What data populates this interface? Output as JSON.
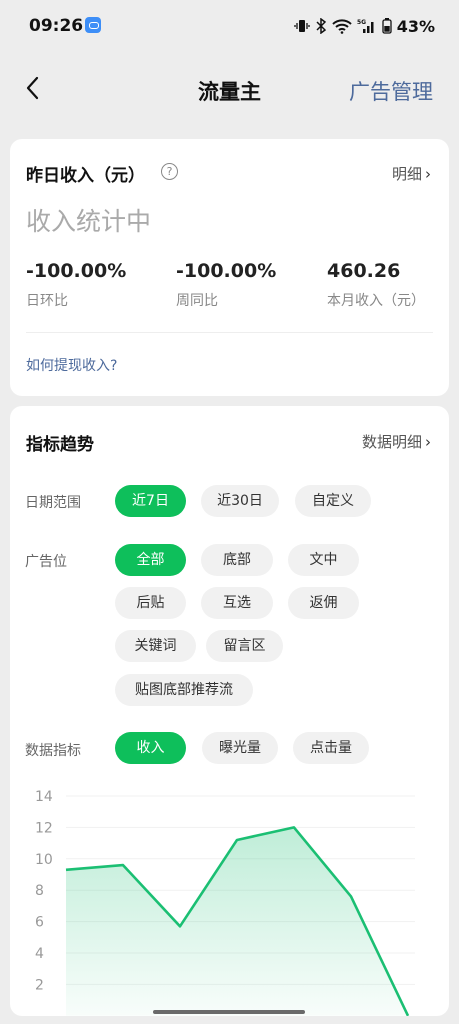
{
  "status_bar": {
    "time": "09:26",
    "battery_pct": "43%",
    "icons": [
      "vibrate-icon",
      "bluetooth-icon",
      "wifi-icon",
      "5g-signal-icon",
      "battery-icon"
    ]
  },
  "nav": {
    "title": "流量主",
    "right_label": "广告管理"
  },
  "income_card": {
    "title": "昨日收入（元）",
    "detail_link": "明细",
    "status_text": "收入统计中",
    "stats": [
      {
        "value": "-100.00%",
        "label": "日环比"
      },
      {
        "value": "-100.00%",
        "label": "周同比"
      },
      {
        "value": "460.26",
        "label": "本月收入（元）"
      }
    ],
    "help_link": "如何提现收入?"
  },
  "trend_card": {
    "title": "指标趋势",
    "detail_link": "数据明细",
    "date_range": {
      "label": "日期范围",
      "options": [
        "近7日",
        "近30日",
        "自定义"
      ],
      "selected": "近7日"
    },
    "ad_slot": {
      "label": "广告位",
      "options": [
        "全部",
        "底部",
        "文中",
        "后贴",
        "互选",
        "返佣",
        "关键词",
        "留言区",
        "贴图底部推荐流"
      ],
      "selected": "全部"
    },
    "metric": {
      "label": "数据指标",
      "options": [
        "收入",
        "曝光量",
        "点击量"
      ],
      "selected": "收入"
    }
  },
  "chart_data": {
    "type": "area",
    "title": "",
    "xlabel": "",
    "ylabel": "",
    "y_ticks": [
      "14",
      "12",
      "10",
      "8",
      "6",
      "4",
      "2"
    ],
    "ylim": [
      0,
      14
    ],
    "values": [
      9.3,
      9.6,
      5.7,
      11.2,
      12.0,
      7.6,
      0.0
    ],
    "color": "#1bbf73",
    "grid": true
  },
  "colors": {
    "accent": "#0ebf5b",
    "link": "#4d6a9c"
  }
}
